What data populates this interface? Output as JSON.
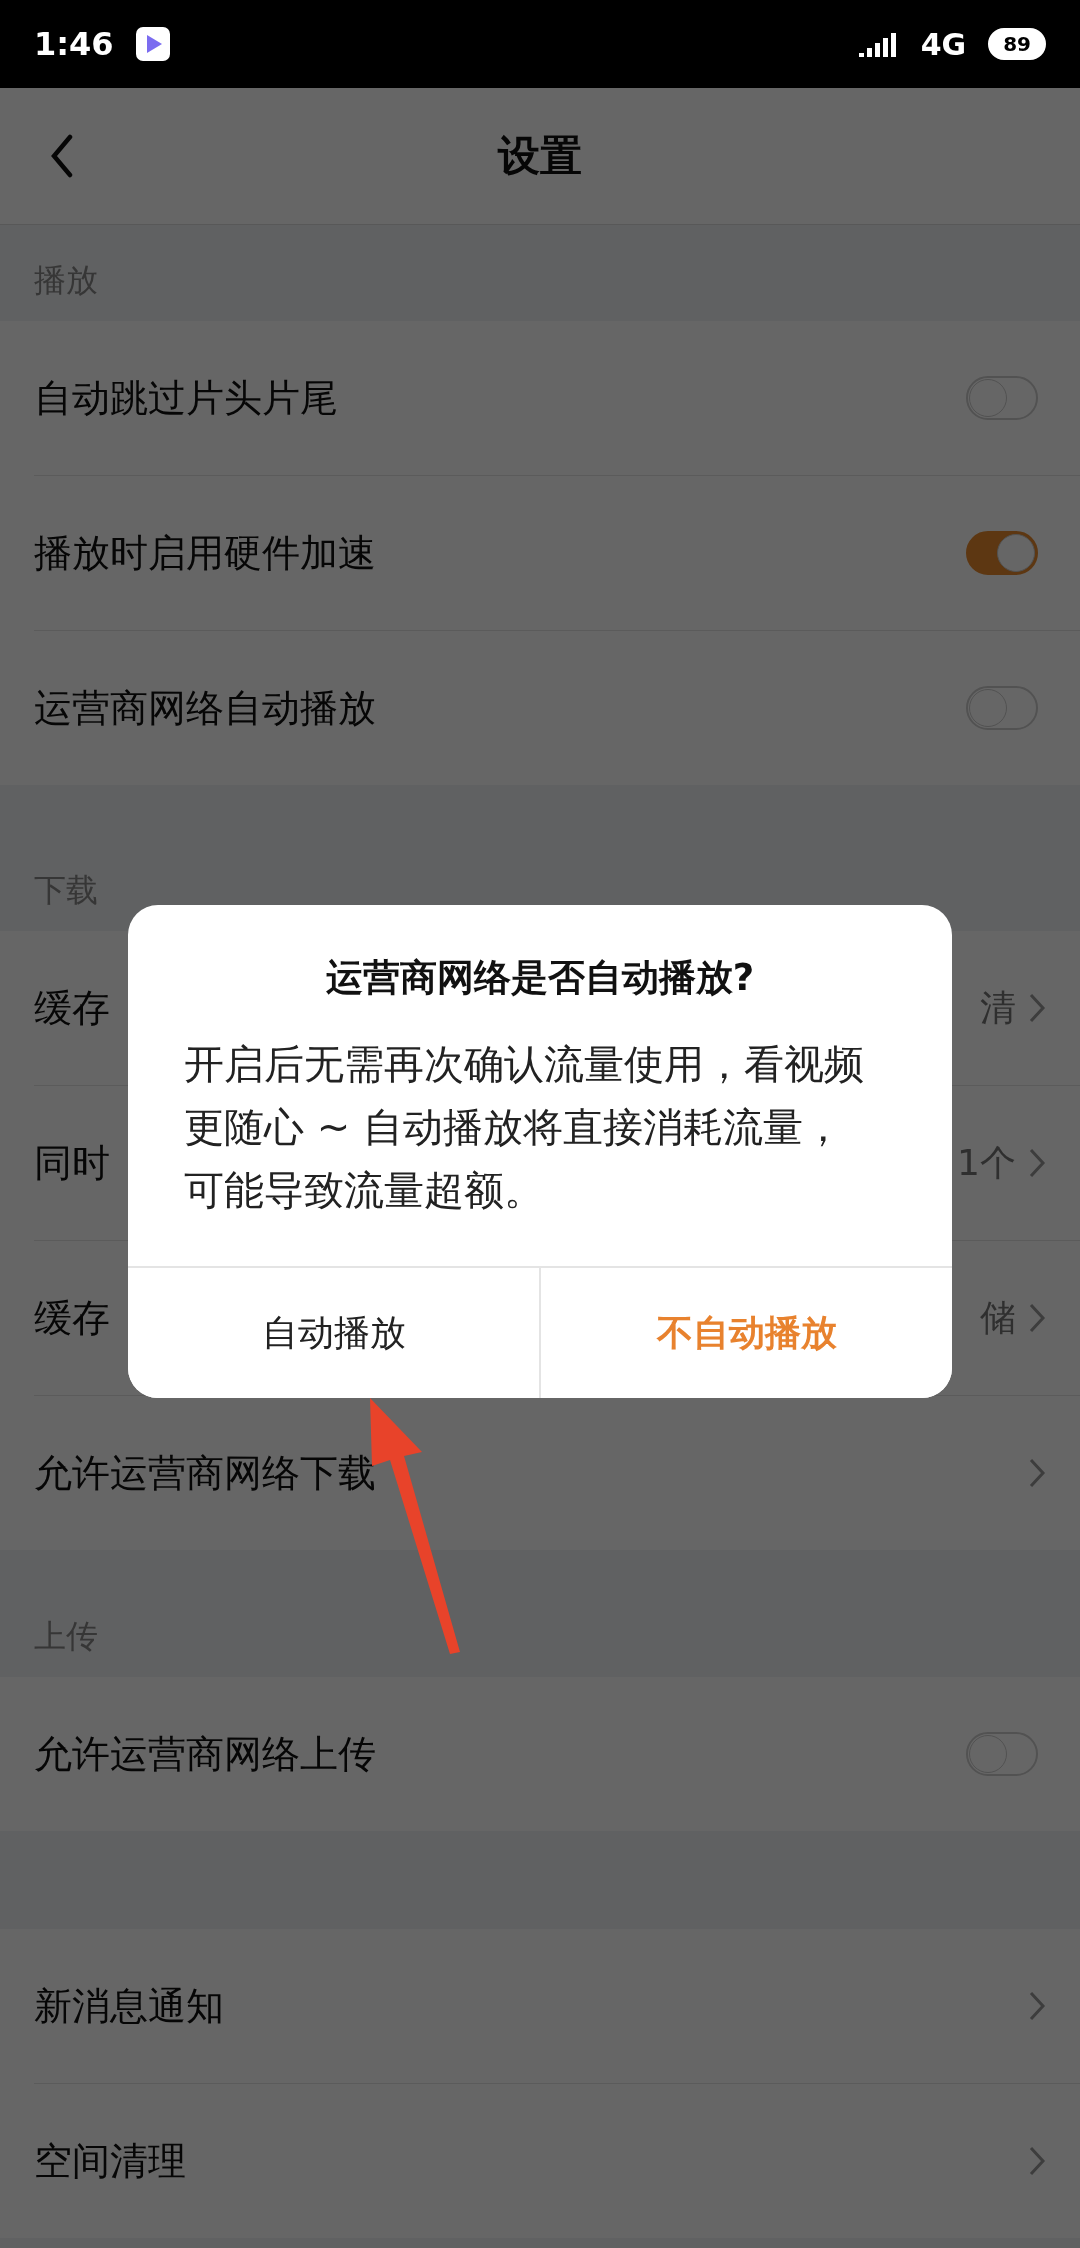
{
  "status_bar": {
    "time": "1:46",
    "network": "4G",
    "battery": "89"
  },
  "header": {
    "title": "设置"
  },
  "sections": [
    {
      "title": "播放",
      "rows": [
        {
          "kind": "toggle",
          "label": "自动跳过片头片尾",
          "on": false
        },
        {
          "kind": "toggle",
          "label": "播放时启用硬件加速",
          "on": true
        },
        {
          "kind": "toggle",
          "label": "运营商网络自动播放",
          "on": false
        }
      ]
    },
    {
      "title": "下载",
      "rows": [
        {
          "kind": "link",
          "label": "缓存",
          "value": "清"
        },
        {
          "kind": "link",
          "label": "同时",
          "value": "1个"
        },
        {
          "kind": "link",
          "label": "缓存",
          "value": "储"
        },
        {
          "kind": "link",
          "label": "允许运营商网络下载"
        }
      ]
    },
    {
      "title": "上传",
      "rows": [
        {
          "kind": "toggle",
          "label": "允许运营商网络上传",
          "on": false
        }
      ]
    },
    {
      "rows": [
        {
          "kind": "link",
          "label": "新消息通知"
        },
        {
          "kind": "link",
          "label": "空间清理"
        }
      ]
    }
  ],
  "dialog": {
    "title": "运营商网络是否自动播放?",
    "message": "开启后无需再次确认流量使用，看视频更随心 ~ 自动播放将直接消耗流量，可能导致流量超额。",
    "buttons": [
      {
        "label": "自动播放",
        "primary": false
      },
      {
        "label": "不自动播放",
        "primary": true
      }
    ]
  }
}
